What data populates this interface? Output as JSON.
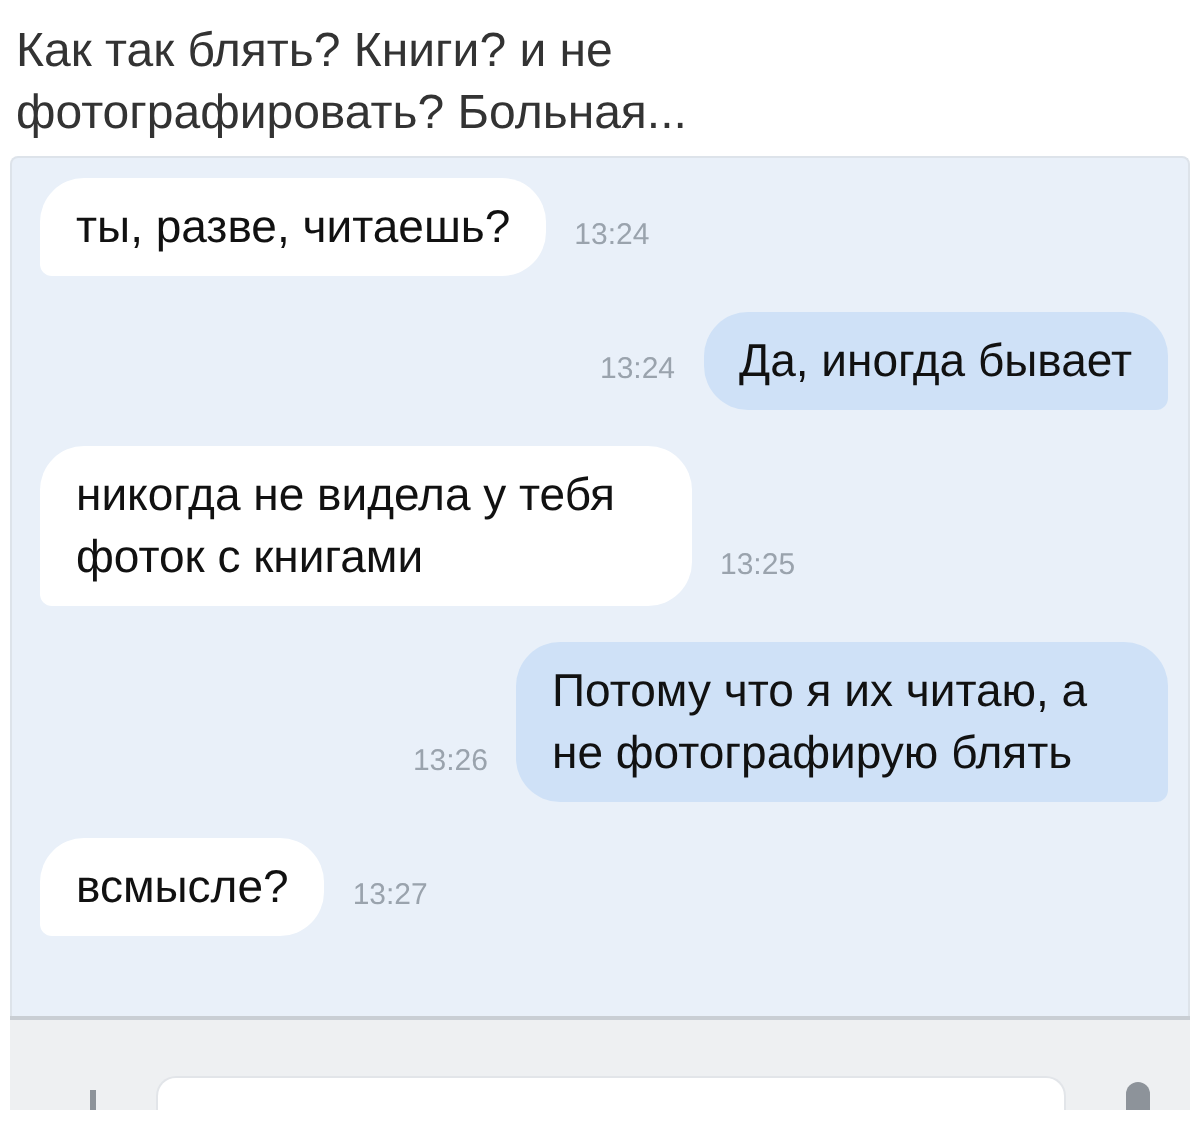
{
  "post": {
    "caption": "Как так блять? Книги? и не фотографировать? Больная..."
  },
  "messages": [
    {
      "kind": "incoming",
      "text": "ты, разве, читаешь?",
      "time": "13:24"
    },
    {
      "kind": "outgoing",
      "text": "Да, иногда бывает",
      "time": "13:24"
    },
    {
      "kind": "incoming",
      "text": "никогда не видела у тебя фоток с книгами",
      "time": "13:25"
    },
    {
      "kind": "outgoing",
      "text": "Потому что я их читаю, а не фотографирую блять",
      "time": "13:26"
    },
    {
      "kind": "incoming",
      "text": "всмысле?",
      "time": "13:27"
    }
  ]
}
